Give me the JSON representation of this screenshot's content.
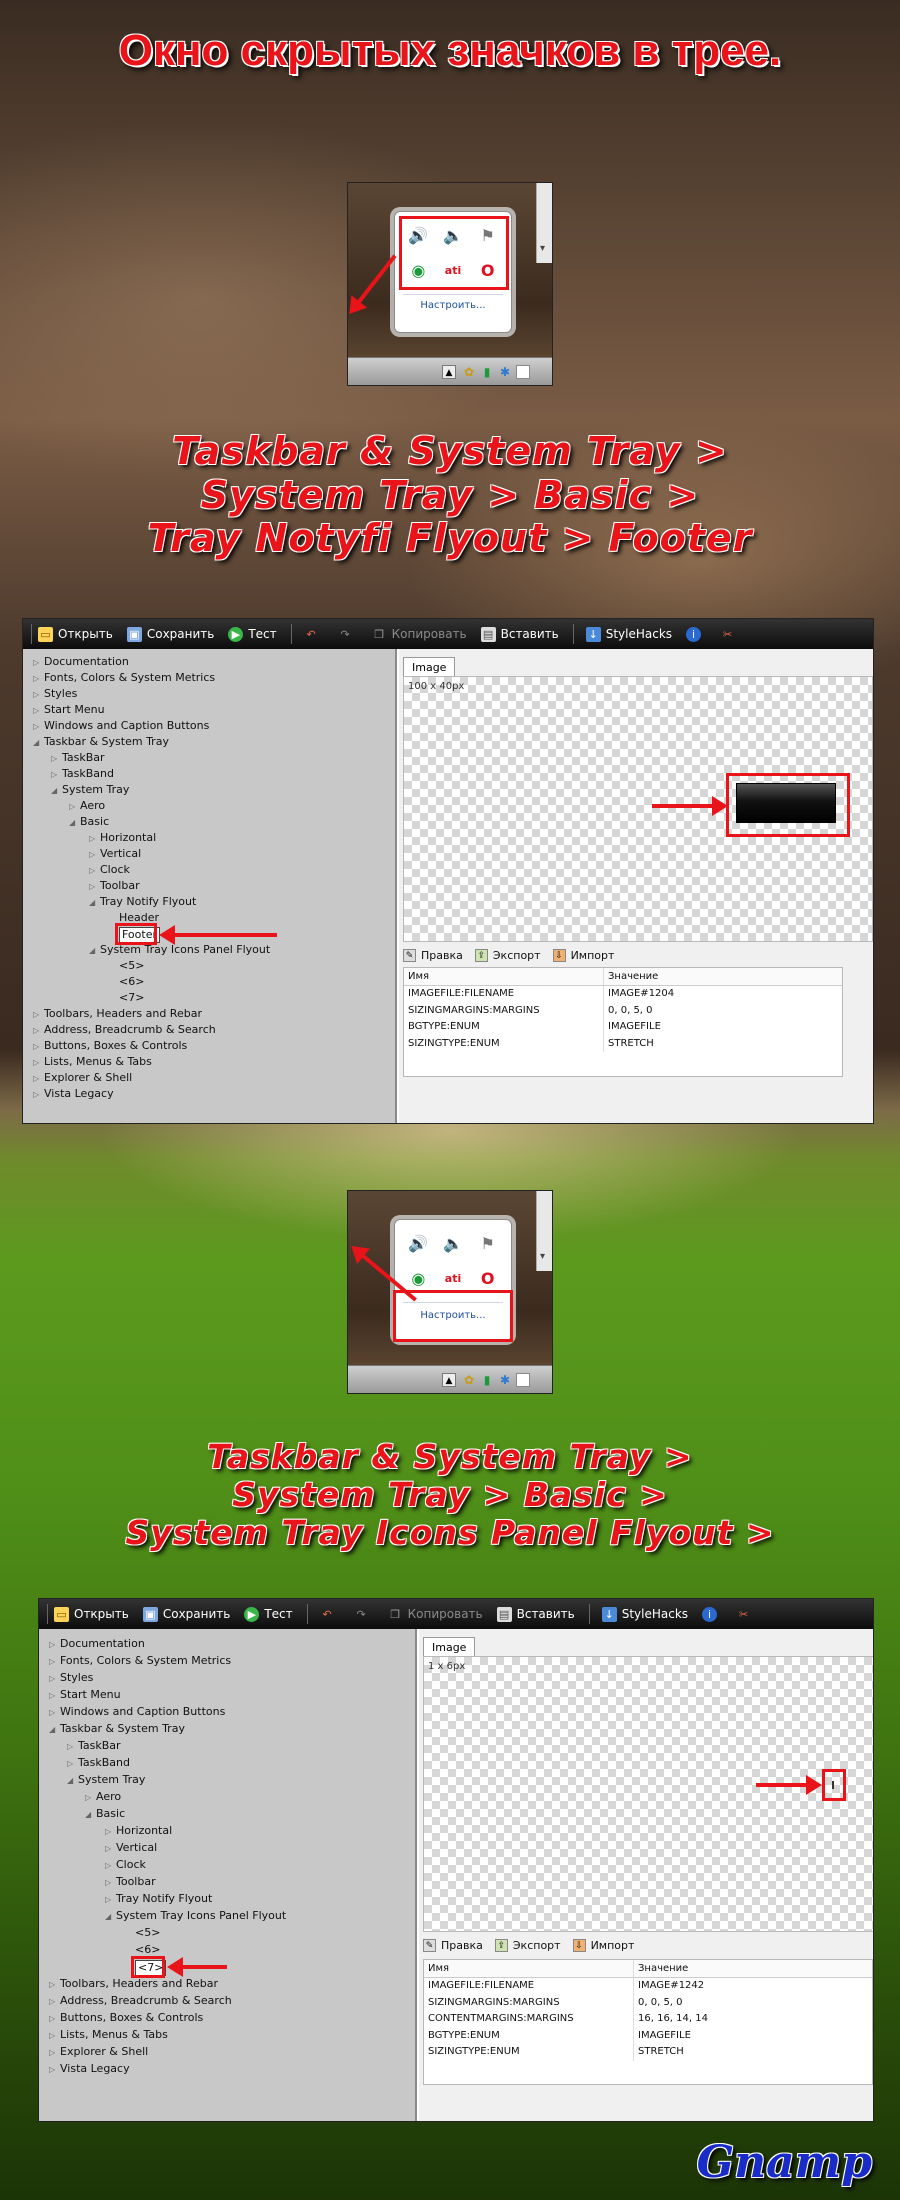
{
  "page": {
    "title": "Окно скрытых значков в трее.",
    "caption1": [
      "Taskbar & System Tray >",
      "System Tray > Basic >",
      "Tray Notyfi Flyout > Footer"
    ],
    "caption2": [
      "Taskbar & System Tray >",
      "System Tray > Basic >",
      "System Tray Icons Panel Flyout >"
    ],
    "signature": "Gnamp"
  },
  "tray": {
    "customize_link": "Настроить...",
    "icons": [
      "volume-icon",
      "volume-muted-icon",
      "action-center-flag-icon",
      "green-circle-icon",
      "ati-icon",
      "opera-icon"
    ]
  },
  "toolbar": {
    "open": "Открыть",
    "save": "Сохранить",
    "test": "Тест",
    "copy": "Копировать",
    "paste": "Вставить",
    "stylehacks": "StyleHacks"
  },
  "tree": {
    "documentation": "Documentation",
    "fonts": "Fonts, Colors & System Metrics",
    "styles": "Styles",
    "start_menu": "Start Menu",
    "windows_caption": "Windows and Caption Buttons",
    "taskbar_tray": "Taskbar & System Tray",
    "taskbar": "TaskBar",
    "taskband": "TaskBand",
    "system_tray": "System Tray",
    "aero": "Aero",
    "basic": "Basic",
    "horizontal": "Horizontal",
    "vertical": "Vertical",
    "clock": "Clock",
    "toolbar": "Toolbar",
    "tray_notify_flyout": "Tray Notify Flyout",
    "header": "Header",
    "footer": "Footer",
    "icons_panel_flyout": "System Tray Icons Panel Flyout",
    "p5": "<5>",
    "p6": "<6>",
    "p7": "<7>",
    "toolbars_headers": "Toolbars, Headers and Rebar",
    "address_breadcrumb": "Address, Breadcrumb & Search",
    "buttons_boxes": "Buttons, Boxes & Controls",
    "lists_menus": "Lists, Menus & Tabs",
    "explorer_shell": "Explorer & Shell",
    "vista_legacy": "Vista Legacy"
  },
  "panel1": {
    "tab": "Image",
    "dimensions": "100 x 40px",
    "tools": [
      "Правка",
      "Экспорт",
      "Импорт"
    ],
    "col_name": "Имя",
    "col_value": "Значение",
    "props": [
      [
        "IMAGEFILE:FILENAME",
        "IMAGE#1204"
      ],
      [
        "SIZINGMARGINS:MARGINS",
        "0, 0, 5, 0"
      ],
      [
        "BGTYPE:ENUM",
        "IMAGEFILE"
      ],
      [
        "SIZINGTYPE:ENUM",
        "STRETCH"
      ]
    ]
  },
  "panel2": {
    "tab": "Image",
    "dimensions": "1 x 6px",
    "tools": [
      "Правка",
      "Экспорт",
      "Импорт"
    ],
    "col_name": "Имя",
    "col_value": "Значение",
    "props": [
      [
        "IMAGEFILE:FILENAME",
        "IMAGE#1242"
      ],
      [
        "SIZINGMARGINS:MARGINS",
        "0, 0, 5, 0"
      ],
      [
        "CONTENTMARGINS:MARGINS",
        "16, 16, 14, 14"
      ],
      [
        "BGTYPE:ENUM",
        "IMAGEFILE"
      ],
      [
        "SIZINGTYPE:ENUM",
        "STRETCH"
      ]
    ]
  },
  "colors": {
    "accent_red": "#e8141a",
    "link_blue": "#1f4fa0",
    "signature_blue": "#1a2cc8"
  }
}
